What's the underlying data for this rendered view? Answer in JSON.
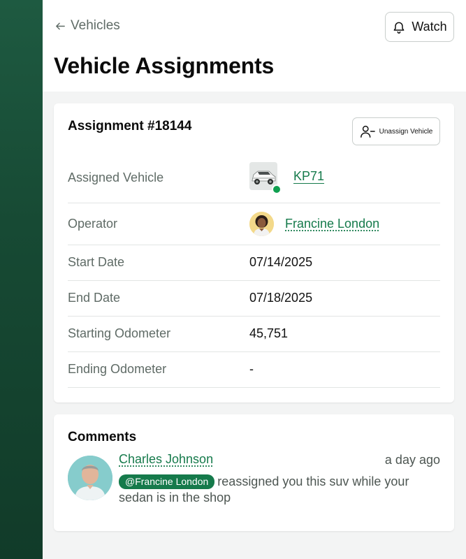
{
  "header": {
    "back_label": "Vehicles",
    "title": "Vehicle Assignments",
    "watch_label": "Watch"
  },
  "assignment": {
    "title": "Assignment #18144",
    "unassign_label": "Unassign Vehicle",
    "rows": [
      {
        "label": "Assigned Vehicle",
        "value": "KP71"
      },
      {
        "label": "Operator",
        "value": "Francine London"
      },
      {
        "label": "Start Date",
        "value": "07/14/2025"
      },
      {
        "label": "End Date",
        "value": "07/18/2025"
      },
      {
        "label": "Starting Odometer",
        "value": "45,751"
      },
      {
        "label": "Ending Odometer",
        "value": "-"
      }
    ],
    "vehicle_status_color": "#10a050"
  },
  "comments": {
    "title": "Comments",
    "items": [
      {
        "author": "Charles Johnson",
        "time": "a day ago",
        "mention": "@Francine London",
        "text": "reassigned you this suv while your sedan is in the shop"
      }
    ]
  },
  "colors": {
    "sidebar": "#174a34",
    "link": "#157a4b"
  }
}
